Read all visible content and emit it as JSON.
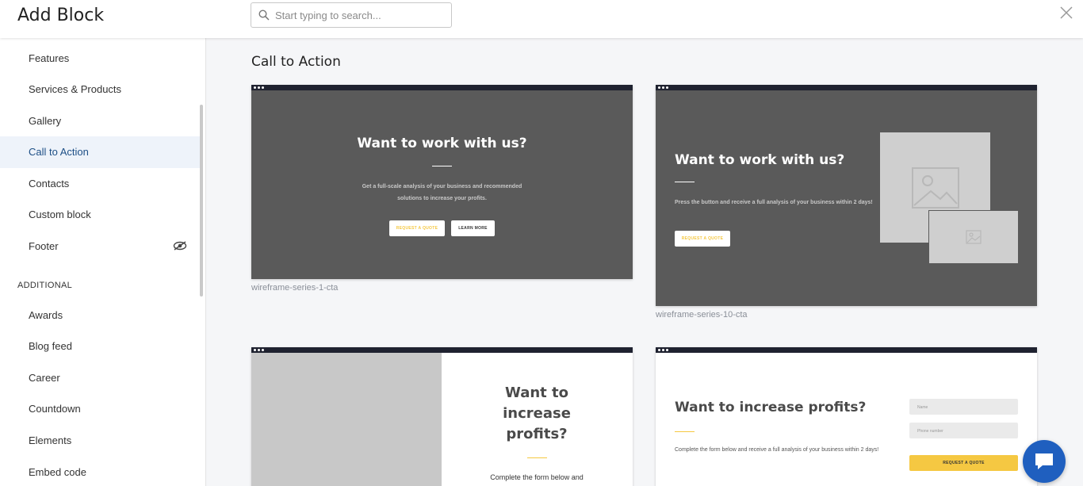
{
  "header": {
    "title": "Add Block",
    "search_placeholder": "Start typing to search...",
    "close_icon": "close-icon"
  },
  "sidebar": {
    "items": [
      {
        "label": "Features"
      },
      {
        "label": "Services & Products"
      },
      {
        "label": "Gallery"
      },
      {
        "label": "Call to Action",
        "active": true
      },
      {
        "label": "Contacts"
      },
      {
        "label": "Custom block"
      },
      {
        "label": "Footer",
        "icon": "eye-hidden-icon"
      }
    ],
    "additional_heading": "ADDITIONAL",
    "additional_items": [
      {
        "label": "Awards"
      },
      {
        "label": "Blog feed"
      },
      {
        "label": "Career"
      },
      {
        "label": "Countdown"
      },
      {
        "label": "Elements"
      },
      {
        "label": "Embed code"
      }
    ]
  },
  "main": {
    "section_title": "Call to Action",
    "cards": [
      {
        "caption": "wireframe-series-1-cta",
        "heading": "Want to work with us?",
        "text": "Get a full-scale analysis of your business and recommended solutions to increase your profits.",
        "button1": "REQUEST A QUOTE",
        "button2": "LEARN MORE"
      },
      {
        "caption": "wireframe-series-10-cta",
        "heading": "Want to work with us?",
        "text": "Press the button and receive a full analysis of your business within 2 days!",
        "button1": "REQUEST A QUOTE"
      },
      {
        "heading": "Want to increase profits?",
        "text": "Complete the form below and"
      },
      {
        "heading": "Want to increase profits?",
        "text": "Complete the form below and receive a full analysis of your business within 2 days!",
        "field1": "Name",
        "field2": "Phone number",
        "button1": "REQUEST A QUOTE"
      }
    ]
  },
  "colors": {
    "accent_yellow": "#f5c842",
    "active_bg": "#eef3fa",
    "card_dark": "#5a5a5a",
    "chat_blue": "#1f5fbf"
  }
}
